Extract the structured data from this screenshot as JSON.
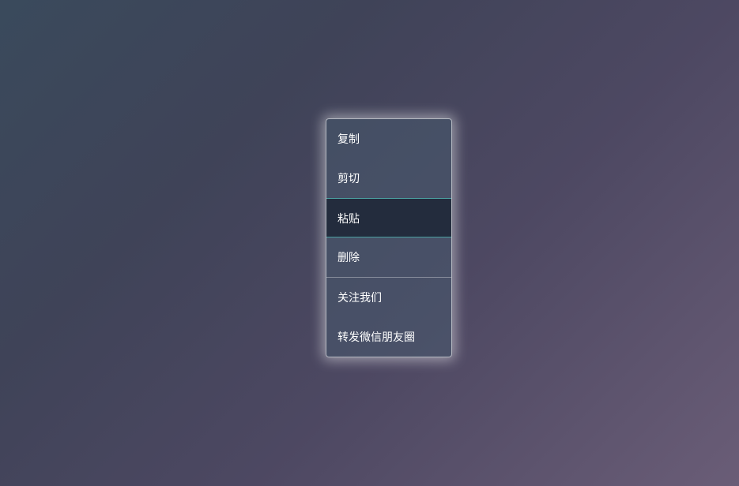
{
  "menu": {
    "groups": [
      {
        "items": [
          {
            "id": "copy",
            "label": "复制",
            "active": false
          },
          {
            "id": "cut",
            "label": "剪切",
            "active": false
          },
          {
            "id": "paste",
            "label": "粘贴",
            "active": true
          },
          {
            "id": "delete",
            "label": "删除",
            "active": false
          }
        ]
      },
      {
        "items": [
          {
            "id": "follow-us",
            "label": "关注我们",
            "active": false
          },
          {
            "id": "share-to-moments",
            "label": "转发微信朋友圈",
            "active": false
          }
        ]
      }
    ]
  }
}
